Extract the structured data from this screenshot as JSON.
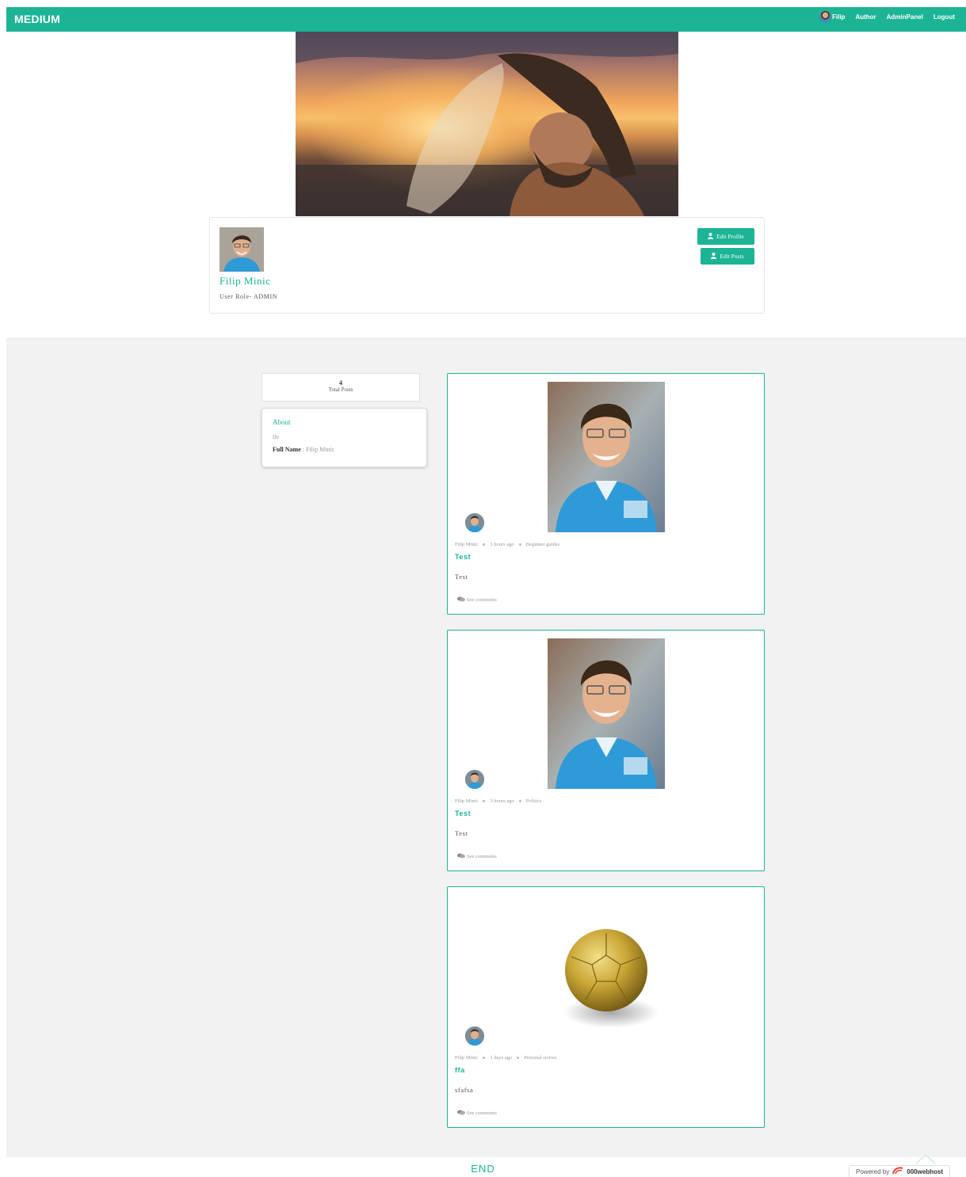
{
  "navbar": {
    "brand": "MEDIUM",
    "user_name": "Filip",
    "links": [
      "Author",
      "AdminPanel",
      "Logout"
    ]
  },
  "profile": {
    "name": "Filip Minic",
    "role": "User Role- ADMIN",
    "edit_profile_label": "Edit Profile",
    "edit_posts_label": "Edit Posts"
  },
  "stats": {
    "total_posts": "4",
    "total_posts_label": "Total Posts"
  },
  "about": {
    "title": "About",
    "bio": "He",
    "full_name_label": "Full Name",
    "full_name_value": " : Filip Minic"
  },
  "posts": [
    {
      "author": "Filip Minic",
      "time": "1 hours ago",
      "category": "Beginner guides",
      "title": "Test",
      "body": "Test",
      "comments": "See comments"
    },
    {
      "author": "Filip Minic",
      "time": "3 hours ago",
      "category": "Politics",
      "title": "Test",
      "body": "Test",
      "comments": "See comments"
    },
    {
      "author": "Filip Minic",
      "time": "1 days ago",
      "category": "Personal stories",
      "title": "ffa",
      "body": "sfafsa",
      "comments": "See comments"
    }
  ],
  "footer": {
    "end": "END",
    "powered_by": "Powered by",
    "host": "000webhost"
  },
  "colors": {
    "accent": "#1cb495",
    "section_bg": "#f2f2f2"
  }
}
